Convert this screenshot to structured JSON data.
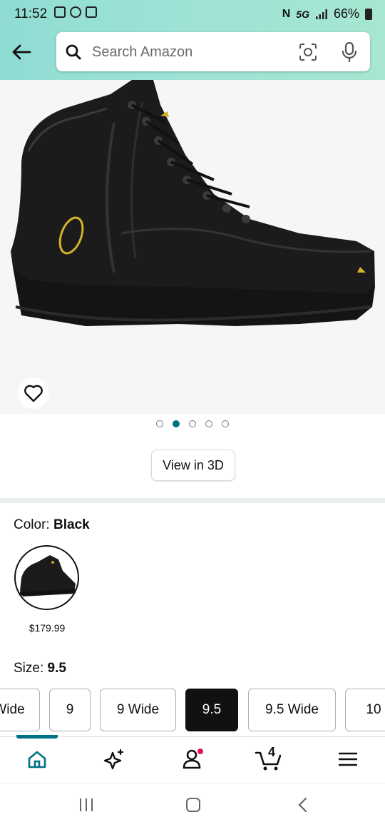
{
  "status_bar": {
    "time": "11:52",
    "network": "5G",
    "battery": "66%"
  },
  "search": {
    "placeholder": "Search Amazon"
  },
  "gallery": {
    "total_images": 5,
    "active_index": 1,
    "view_3d_label": "View in 3D"
  },
  "color": {
    "label": "Color:",
    "value": "Black",
    "swatch_price": "$179.99"
  },
  "size": {
    "label": "Size:",
    "value": "9.5",
    "options": [
      "Wide",
      "9",
      "9 Wide",
      "9.5",
      "9.5 Wide",
      "10"
    ],
    "selected": "9.5"
  },
  "bottom_nav": {
    "cart_count": "4",
    "items": [
      "home-icon",
      "sparkle-icon",
      "account-icon",
      "cart-icon",
      "menu-icon"
    ]
  },
  "colors": {
    "accent": "#007185",
    "header": "#9fe3d6",
    "notification": "#e0115f"
  }
}
